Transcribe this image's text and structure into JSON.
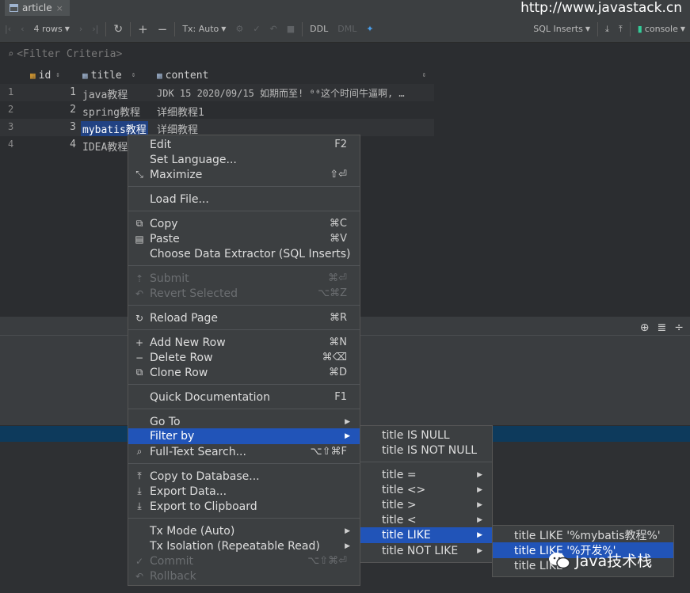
{
  "tab": {
    "icon": "table-icon",
    "label": "article",
    "close": "×"
  },
  "watermark": "http://www.javastack.cn",
  "toolbar": {
    "rows_label": "4 rows",
    "tx_label": "Tx: Auto",
    "ddl": "DDL",
    "dml": "DML",
    "sql_inserts": "SQL Inserts",
    "console": "console"
  },
  "filter": {
    "placeholder": "<Filter Criteria>"
  },
  "grid": {
    "columns": [
      "id",
      "title",
      "content"
    ],
    "rows": [
      {
        "num": "1",
        "id": "1",
        "title": "java教程",
        "content": "JDK 15 2020/09/15 如期而至! ⁰⁰这个时间牛逼啊, …"
      },
      {
        "num": "2",
        "id": "2",
        "title": "spring教程",
        "content": "详细教程1"
      },
      {
        "num": "3",
        "id": "3",
        "title": "mybatis教程",
        "content": "详细教程"
      },
      {
        "num": "4",
        "id": "4",
        "title": "IDEA教程",
        "content": ""
      }
    ]
  },
  "context_menu": [
    {
      "label": "Edit",
      "shortcut": "F2"
    },
    {
      "label": "Set Language..."
    },
    {
      "label": "Maximize",
      "shortcut": "⇧⏎"
    },
    {
      "label": "Load File..."
    },
    {
      "label": "Copy",
      "shortcut": "⌘C"
    },
    {
      "label": "Paste",
      "shortcut": "⌘V"
    },
    {
      "label": "Choose Data Extractor (SQL Inserts)"
    },
    {
      "label": "Submit",
      "shortcut": "⌘⏎"
    },
    {
      "label": "Revert Selected",
      "shortcut": "⌥⌘Z"
    },
    {
      "label": "Reload Page",
      "shortcut": "⌘R"
    },
    {
      "label": "Add New Row",
      "shortcut": "⌘N"
    },
    {
      "label": "Delete Row",
      "shortcut": "⌘⌫"
    },
    {
      "label": "Clone Row",
      "shortcut": "⌘D"
    },
    {
      "label": "Quick Documentation",
      "shortcut": "F1"
    },
    {
      "label": "Go To"
    },
    {
      "label": "Filter by"
    },
    {
      "label": "Full-Text Search...",
      "shortcut": "⌥⇧⌘F"
    },
    {
      "label": "Copy to Database..."
    },
    {
      "label": "Export Data..."
    },
    {
      "label": "Export to Clipboard"
    },
    {
      "label": "Tx Mode (Auto)"
    },
    {
      "label": "Tx Isolation (Repeatable Read)"
    },
    {
      "label": "Commit",
      "shortcut": "⌥⇧⌘⏎"
    },
    {
      "label": "Rollback"
    }
  ],
  "filter_submenu": [
    "title IS NULL",
    "title IS NOT NULL",
    "title =",
    "title <>",
    "title >",
    "title <",
    "title LIKE",
    "title NOT LIKE"
  ],
  "like_submenu": [
    "title LIKE '%mybatis教程%'",
    "title LIKE '%开发%'",
    "title LIKE"
  ],
  "wechat_watermark": "Java技术栈",
  "colors": {
    "highlight": "#2154b8",
    "menu_bg": "#3c3f41",
    "selected_cell": "#214283"
  }
}
